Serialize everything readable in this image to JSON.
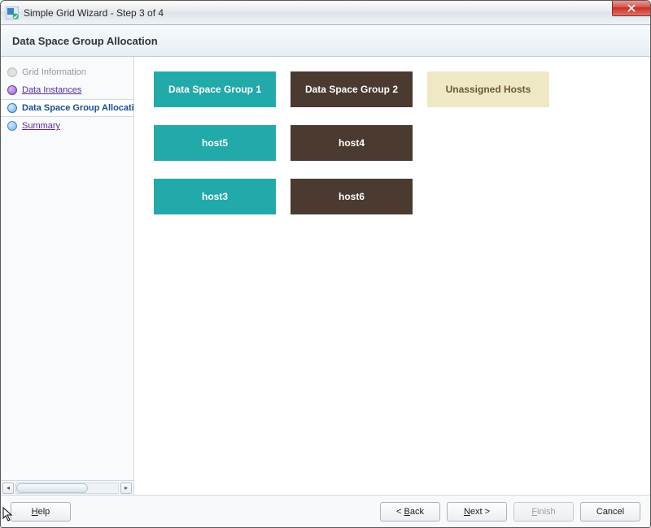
{
  "window": {
    "title": "Simple Grid Wizard - Step 3 of 4"
  },
  "header": {
    "title": "Data Space Group Allocation"
  },
  "steps": {
    "items": [
      {
        "label": "Grid Information",
        "state": "disabled"
      },
      {
        "label": "Data Instances",
        "state": "visited"
      },
      {
        "label": "Data Space Group Allocation",
        "state": "current"
      },
      {
        "label": "Summary",
        "state": "pending"
      }
    ]
  },
  "allocation": {
    "columns": [
      {
        "key": "group1",
        "header": "Data Space Group 1",
        "color": "teal",
        "hosts": [
          "host5",
          "host3"
        ]
      },
      {
        "key": "group2",
        "header": "Data Space Group 2",
        "color": "brown",
        "hosts": [
          "host4",
          "host6"
        ]
      },
      {
        "key": "unassigned",
        "header": "Unassigned Hosts",
        "color": "cream",
        "hosts": []
      }
    ]
  },
  "buttons": {
    "help": "Help",
    "back": "< Back",
    "next": "Next >",
    "finish": "Finish",
    "cancel": "Cancel"
  },
  "mnemonic": {
    "help": "H",
    "back": "B",
    "next": "N",
    "finish": "F"
  }
}
